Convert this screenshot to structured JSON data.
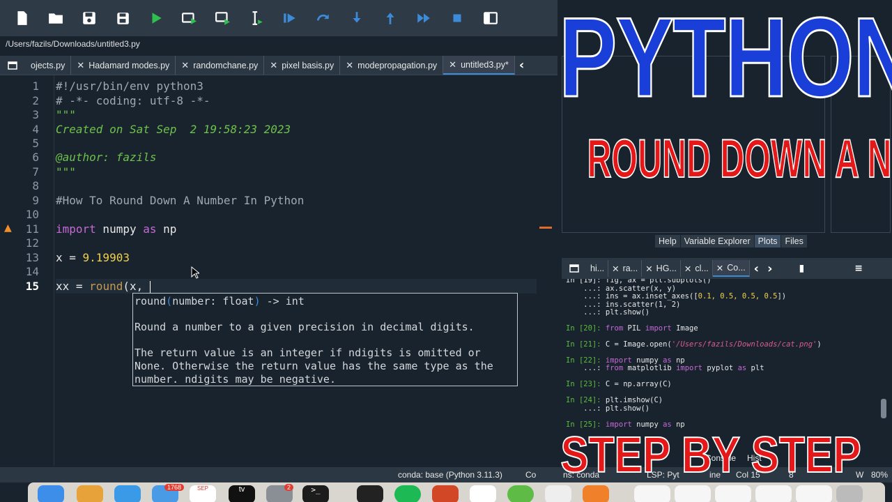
{
  "toolbar": {
    "icons": [
      "new-file-icon",
      "open-folder-icon",
      "save-icon",
      "save-all-icon",
      "run-icon",
      "run-cell-icon",
      "run-cell-advance-icon",
      "run-selection-icon",
      "debug-icon",
      "step-over-icon",
      "step-into-icon",
      "step-out-icon",
      "continue-icon",
      "stop-icon",
      "maximize-pane-icon"
    ]
  },
  "path": "/Users/fazils/Downloads/untitled3.py",
  "editor_tabs": [
    {
      "label": "ojects.py",
      "closable": false
    },
    {
      "label": "Hadamard modes.py",
      "closable": true
    },
    {
      "label": "randomchane.py",
      "closable": true
    },
    {
      "label": "pixel basis.py",
      "closable": true
    },
    {
      "label": "modepropagation.py",
      "closable": true
    },
    {
      "label": "untitled3.py*",
      "closable": true,
      "active": true
    }
  ],
  "editor": {
    "line_numbers": [
      "1",
      "2",
      "3",
      "4",
      "5",
      "6",
      "7",
      "8",
      "9",
      "10",
      "11",
      "12",
      "13",
      "14",
      "15"
    ],
    "lines": {
      "l1": "#!/usr/bin/env python3",
      "l2": "# -*- coding: utf-8 -*-",
      "l3": "\"\"\"",
      "l4": "Created on Sat Sep  2 19:58:23 2023",
      "l6": "@author: fazils",
      "l7": "\"\"\"",
      "l9": "#How To Round Down A Number In Python",
      "l11_kw1": "import",
      "l11_mod": " numpy ",
      "l11_kw2": "as",
      "l11_alias": " np",
      "l13_var": "x = ",
      "l13_num": "9.19903",
      "l15_var": "xx = ",
      "l15_fn": "round",
      "l15_rest": "(x, "
    }
  },
  "tooltip": {
    "sig_name": "round",
    "sig_open": "(",
    "sig_params": "number: float",
    "sig_close": ")",
    "sig_ret": " -> int",
    "line1": "Round a number to a given precision in decimal digits.",
    "line2": "The return value is an integer if ndigits is omitted or",
    "line3": "None. Otherwise the return value has the same type as the",
    "line4": "number. ndigits may be negative."
  },
  "plots_tabs": [
    "Help",
    "Variable Explorer",
    "Plots",
    "Files"
  ],
  "console_tabs": [
    "hi...",
    "ra...",
    "HG...",
    "cl...",
    "Co..."
  ],
  "console": {
    "r0": "In [19]: fig, ax = plt.subplots()",
    "r1": "    ...: ax.scatter(x, y)",
    "r2a": "    ...: ins = ax.inset_axes([",
    "r2b": "0.1, 0.5, 0.5, 0.5",
    "r2c": "])",
    "r3": "    ...: ins.scatter(1, 2)",
    "r4": "    ...: plt.show()",
    "r5_prompt": "In [20]: ",
    "r5_a": "from",
    "r5_b": " PIL ",
    "r5_c": "import",
    "r5_d": " Image",
    "r6_prompt": "In [21]: ",
    "r6_a": "C = Image.open(",
    "r6_str": "'/Users/fazils/Downloads/cat.png'",
    "r6_b": ")",
    "r7_prompt": "In [22]: ",
    "r7_a": "import",
    "r7_b": " numpy ",
    "r7_c": "as",
    "r7_d": " np",
    "r8_a": "    ...: ",
    "r8_b": "from",
    "r8_c": " matplotlib ",
    "r8_d": "import",
    "r8_e": " pyplot ",
    "r8_f": "as",
    "r8_g": " plt",
    "r9_prompt": "In [23]: ",
    "r9_a": "C = np.array(C)",
    "r10_prompt": "In [24]: ",
    "r10_a": "plt.imshow(C)",
    "r11": "    ...: plt.show()",
    "r12_prompt": "In [25]: ",
    "r12_a": "import",
    "r12_b": " numpy ",
    "r12_c": "as",
    "r12_d": " np"
  },
  "status": {
    "conda": "conda: base (Python 3.11.3)",
    "completions": "Co",
    "completions2": "ns: conda",
    "lsp": "LSP: Pyt",
    "line_frag": "ine",
    "col": "Col 15",
    "enc": "8",
    "mem": "W",
    "pct": "80%"
  },
  "bottom_tabs": [
    "Console",
    "Hist"
  ],
  "dock": {
    "mail_badge": "1768",
    "calendar_month": "SEP",
    "settings_badge": "2",
    "tv_label": "tv"
  },
  "overlay": {
    "title1": "PYTHON",
    "title2": "ROUND DOWN A NUMBER",
    "title3": "STEP BY STEP"
  },
  "colors": {
    "accent": "#3c8bd9",
    "overlay_blue": "#1a3fd9",
    "overlay_red": "#e41818"
  }
}
